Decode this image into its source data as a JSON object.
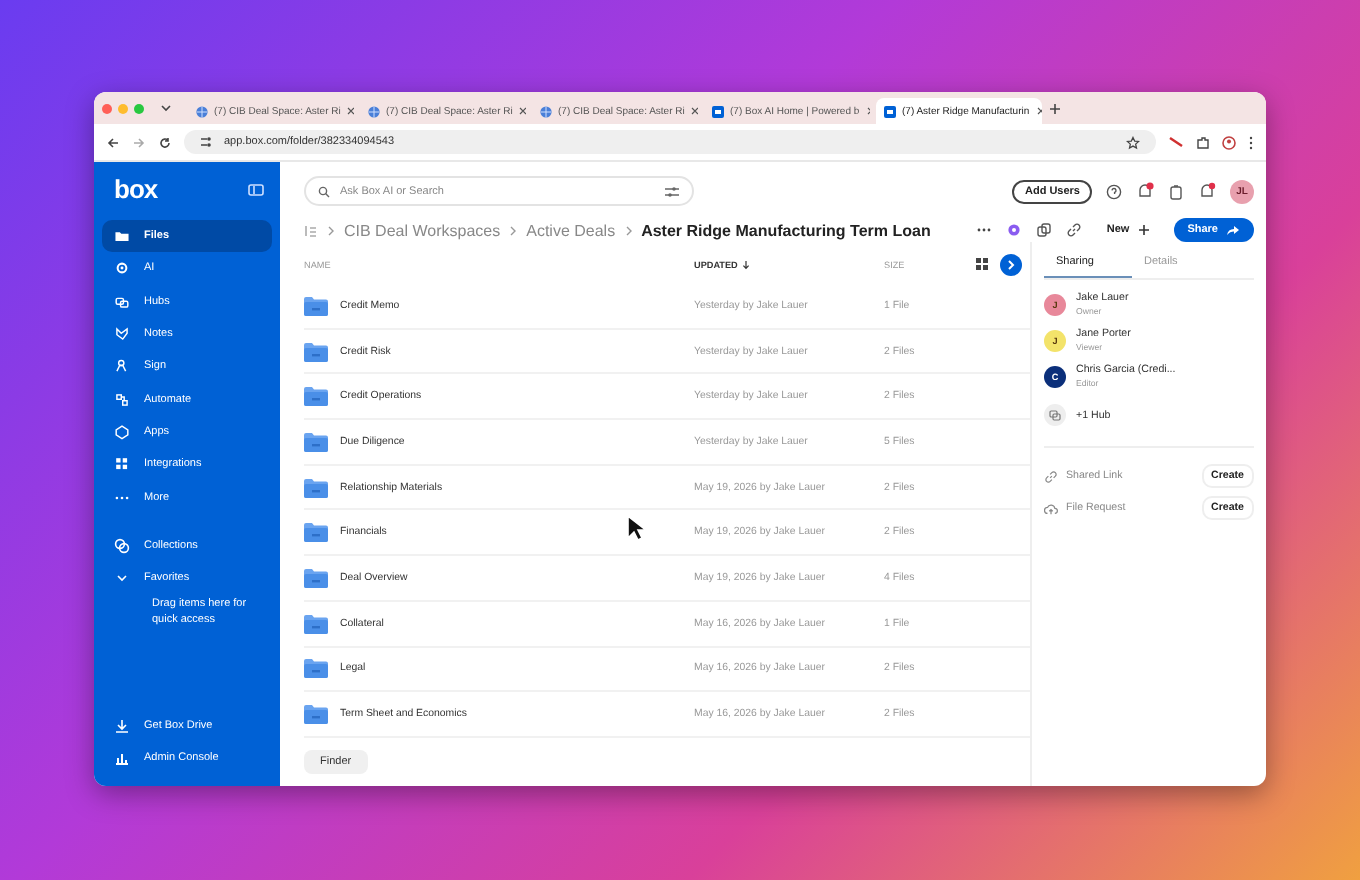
{
  "browser": {
    "tabs": [
      {
        "title": "(7) CIB Deal Space: Aster Ri",
        "kind": "globe",
        "selected": false
      },
      {
        "title": "(7) CIB Deal Space: Aster Ri",
        "kind": "globe",
        "selected": false
      },
      {
        "title": "(7) CIB Deal Space: Aster Ri",
        "kind": "globe",
        "selected": false
      },
      {
        "title": "(7) Box AI Home | Powered b",
        "kind": "box",
        "selected": false
      },
      {
        "title": "(7) Aster Ridge Manufacturin",
        "kind": "box",
        "selected": true
      }
    ],
    "url": "app.box.com/folder/382334094543"
  },
  "sidebar": {
    "logo": "box",
    "items": [
      {
        "label": "Files",
        "selected": true
      },
      {
        "label": "AI",
        "selected": false
      },
      {
        "label": "Hubs",
        "selected": false
      },
      {
        "label": "Notes",
        "selected": false
      },
      {
        "label": "Sign",
        "selected": false
      },
      {
        "label": "Automate",
        "selected": false
      },
      {
        "label": "Apps",
        "selected": false
      },
      {
        "label": "Integrations",
        "selected": false
      },
      {
        "label": "More",
        "selected": false
      }
    ],
    "sections": [
      {
        "label": "Collections",
        "expanded": false
      },
      {
        "label": "Favorites",
        "expanded": true
      }
    ],
    "favorites_hint": "Drag items here for quick access",
    "bottom_items": [
      "Get Box Drive",
      "Admin Console"
    ]
  },
  "header": {
    "search": {
      "placeholder": "Ask Box AI or Search"
    },
    "add_users": "Add Users",
    "avatar": "JL"
  },
  "breadcrumbs": [
    "CIB Deal Workspaces",
    "Active Deals",
    "Aster Ridge Manufacturing Term Loan"
  ],
  "actions": {
    "new": "New",
    "share": "Share"
  },
  "table": {
    "columns": [
      "NAME",
      "UPDATED",
      "SIZE"
    ],
    "rows": [
      {
        "name": "Credit Memo",
        "updated": "Yesterday by Jake Lauer",
        "size": "1 File"
      },
      {
        "name": "Credit Risk",
        "updated": "Yesterday by Jake Lauer",
        "size": "2 Files"
      },
      {
        "name": "Credit Operations",
        "updated": "Yesterday by Jake Lauer",
        "size": "2 Files"
      },
      {
        "name": "Due Diligence",
        "updated": "Yesterday by Jake Lauer",
        "size": "5 Files"
      },
      {
        "name": "Relationship Materials",
        "updated": "May 19, 2026 by Jake Lauer",
        "size": "2 Files"
      },
      {
        "name": "Financials",
        "updated": "May 19, 2026 by Jake Lauer",
        "size": "2 Files"
      },
      {
        "name": "Deal Overview",
        "updated": "May 19, 2026 by Jake Lauer",
        "size": "4 Files"
      },
      {
        "name": "Collateral",
        "updated": "May 16, 2026 by Jake Lauer",
        "size": "1 File"
      },
      {
        "name": "Legal",
        "updated": "May 16, 2026 by Jake Lauer",
        "size": "2 Files"
      },
      {
        "name": "Term Sheet and Economics",
        "updated": "May 16, 2026 by Jake Lauer",
        "size": "2 Files"
      }
    ]
  },
  "panel": {
    "tabs": [
      {
        "label": "Sharing",
        "selected": true
      },
      {
        "label": "Details",
        "selected": false
      }
    ],
    "people": [
      {
        "initial": "J",
        "name": "Jake Lauer",
        "role": "Owner",
        "color": "#e8889a"
      },
      {
        "initial": "J",
        "name": "Jane Porter",
        "role": "Viewer",
        "color": "#f3e36a"
      },
      {
        "initial": "C",
        "name": "Chris Garcia (Credi...",
        "role": "Editor",
        "color": "#0b2f7a"
      }
    ],
    "hub": "+1 Hub",
    "links": [
      {
        "label": "Shared Link",
        "action": "Create"
      },
      {
        "label": "File Request",
        "action": "Create"
      }
    ]
  },
  "dock_tooltip": "Finder"
}
